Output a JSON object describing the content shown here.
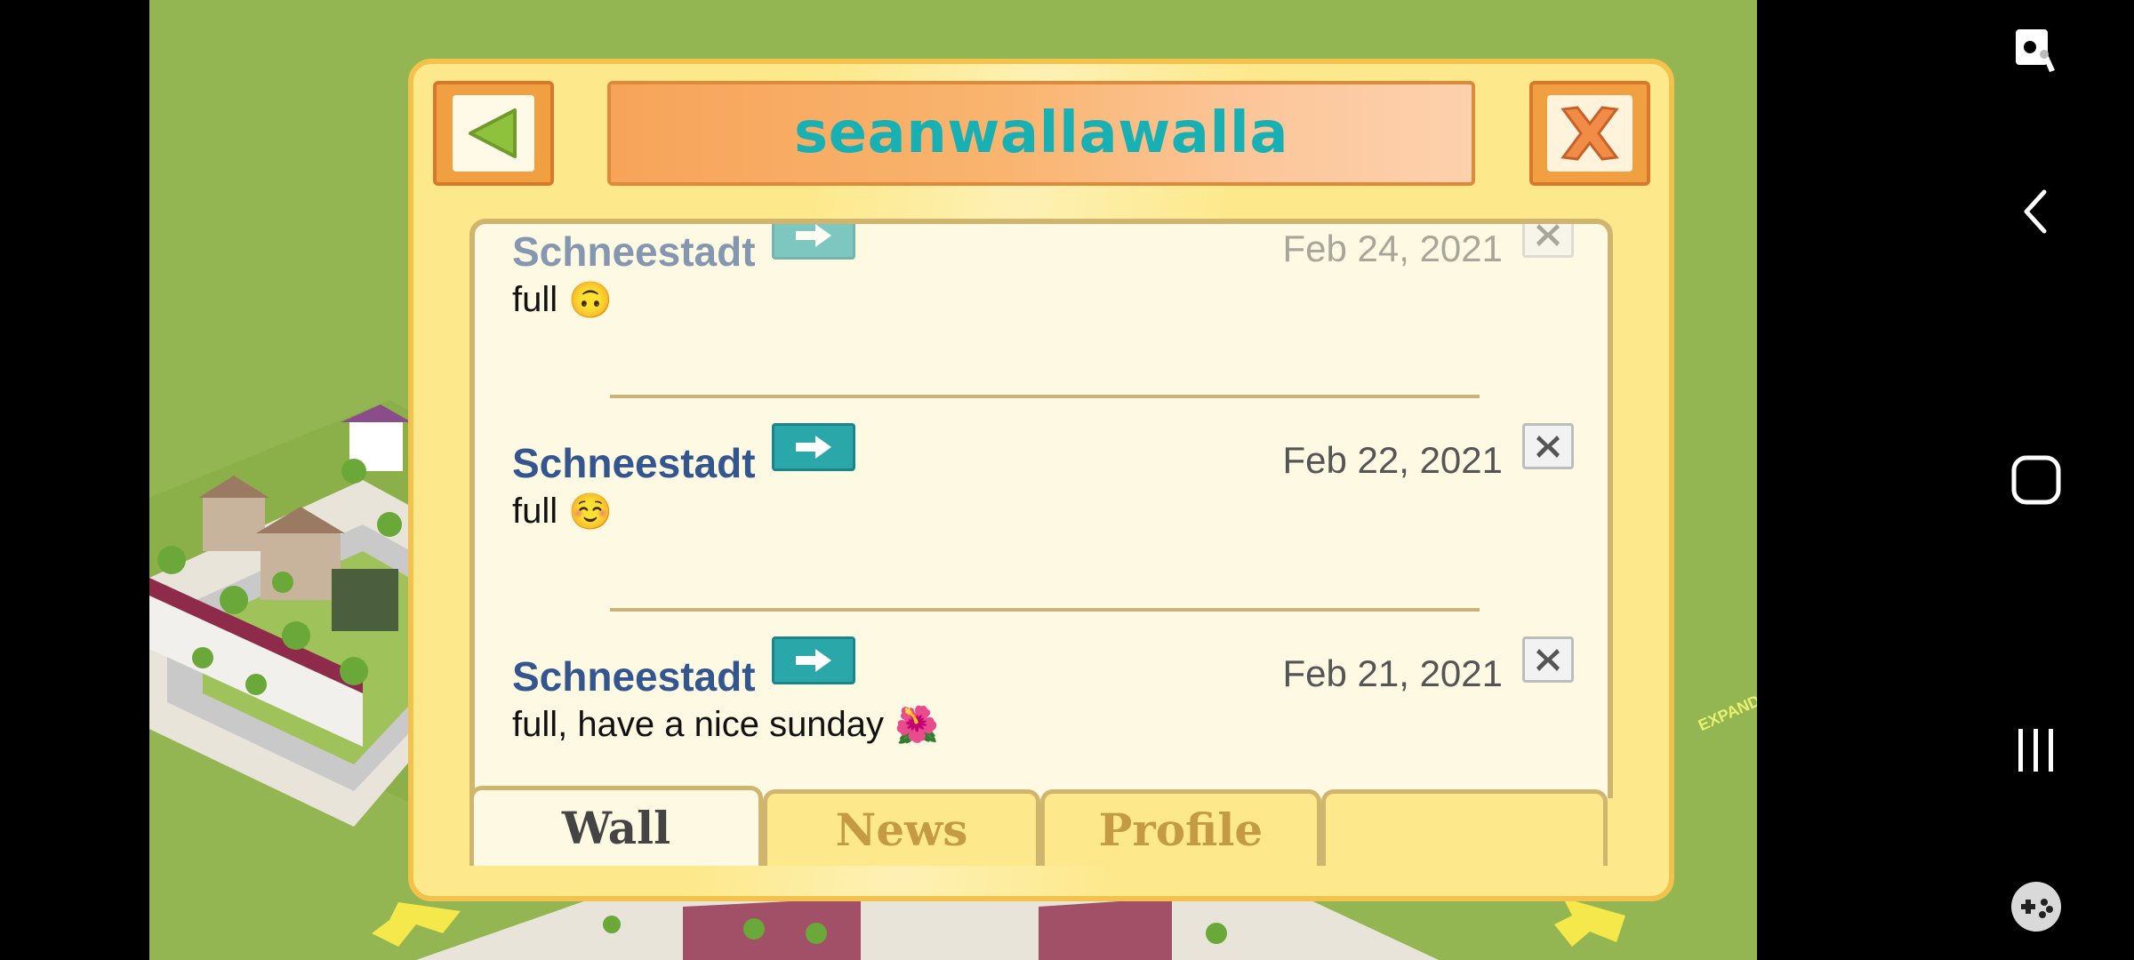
{
  "popup": {
    "title": "seanwallawalla",
    "back_icon": "back-arrow-icon",
    "close_icon": "close-x-icon"
  },
  "wall": {
    "posts": [
      {
        "author": "Schneestadt",
        "date": "Feb 24, 2021",
        "message": "full",
        "emoji": "🙃"
      },
      {
        "author": "Schneestadt",
        "date": "Feb 22, 2021",
        "message": "full",
        "emoji": "☺️"
      },
      {
        "author": "Schneestadt",
        "date": "Feb 21, 2021",
        "message": "full, have a nice sunday",
        "emoji": "🌺"
      }
    ]
  },
  "tabs": [
    {
      "label": "Wall",
      "active": true
    },
    {
      "label": "News",
      "active": false
    },
    {
      "label": "Profile",
      "active": false
    },
    {
      "label": "",
      "active": false
    }
  ],
  "map": {
    "expand_label": "EXPAND"
  },
  "colors": {
    "title_text": "#19b0b4",
    "author_text": "#34568f",
    "popup_bg": "#fde98c",
    "panel_bg": "#fef9e3",
    "accent_teal": "#2aa7a9"
  },
  "system_nav": {
    "icons": [
      "screenshot-edit-icon",
      "back-nav-icon",
      "home-nav-icon",
      "recents-nav-icon",
      "game-tools-icon"
    ]
  }
}
